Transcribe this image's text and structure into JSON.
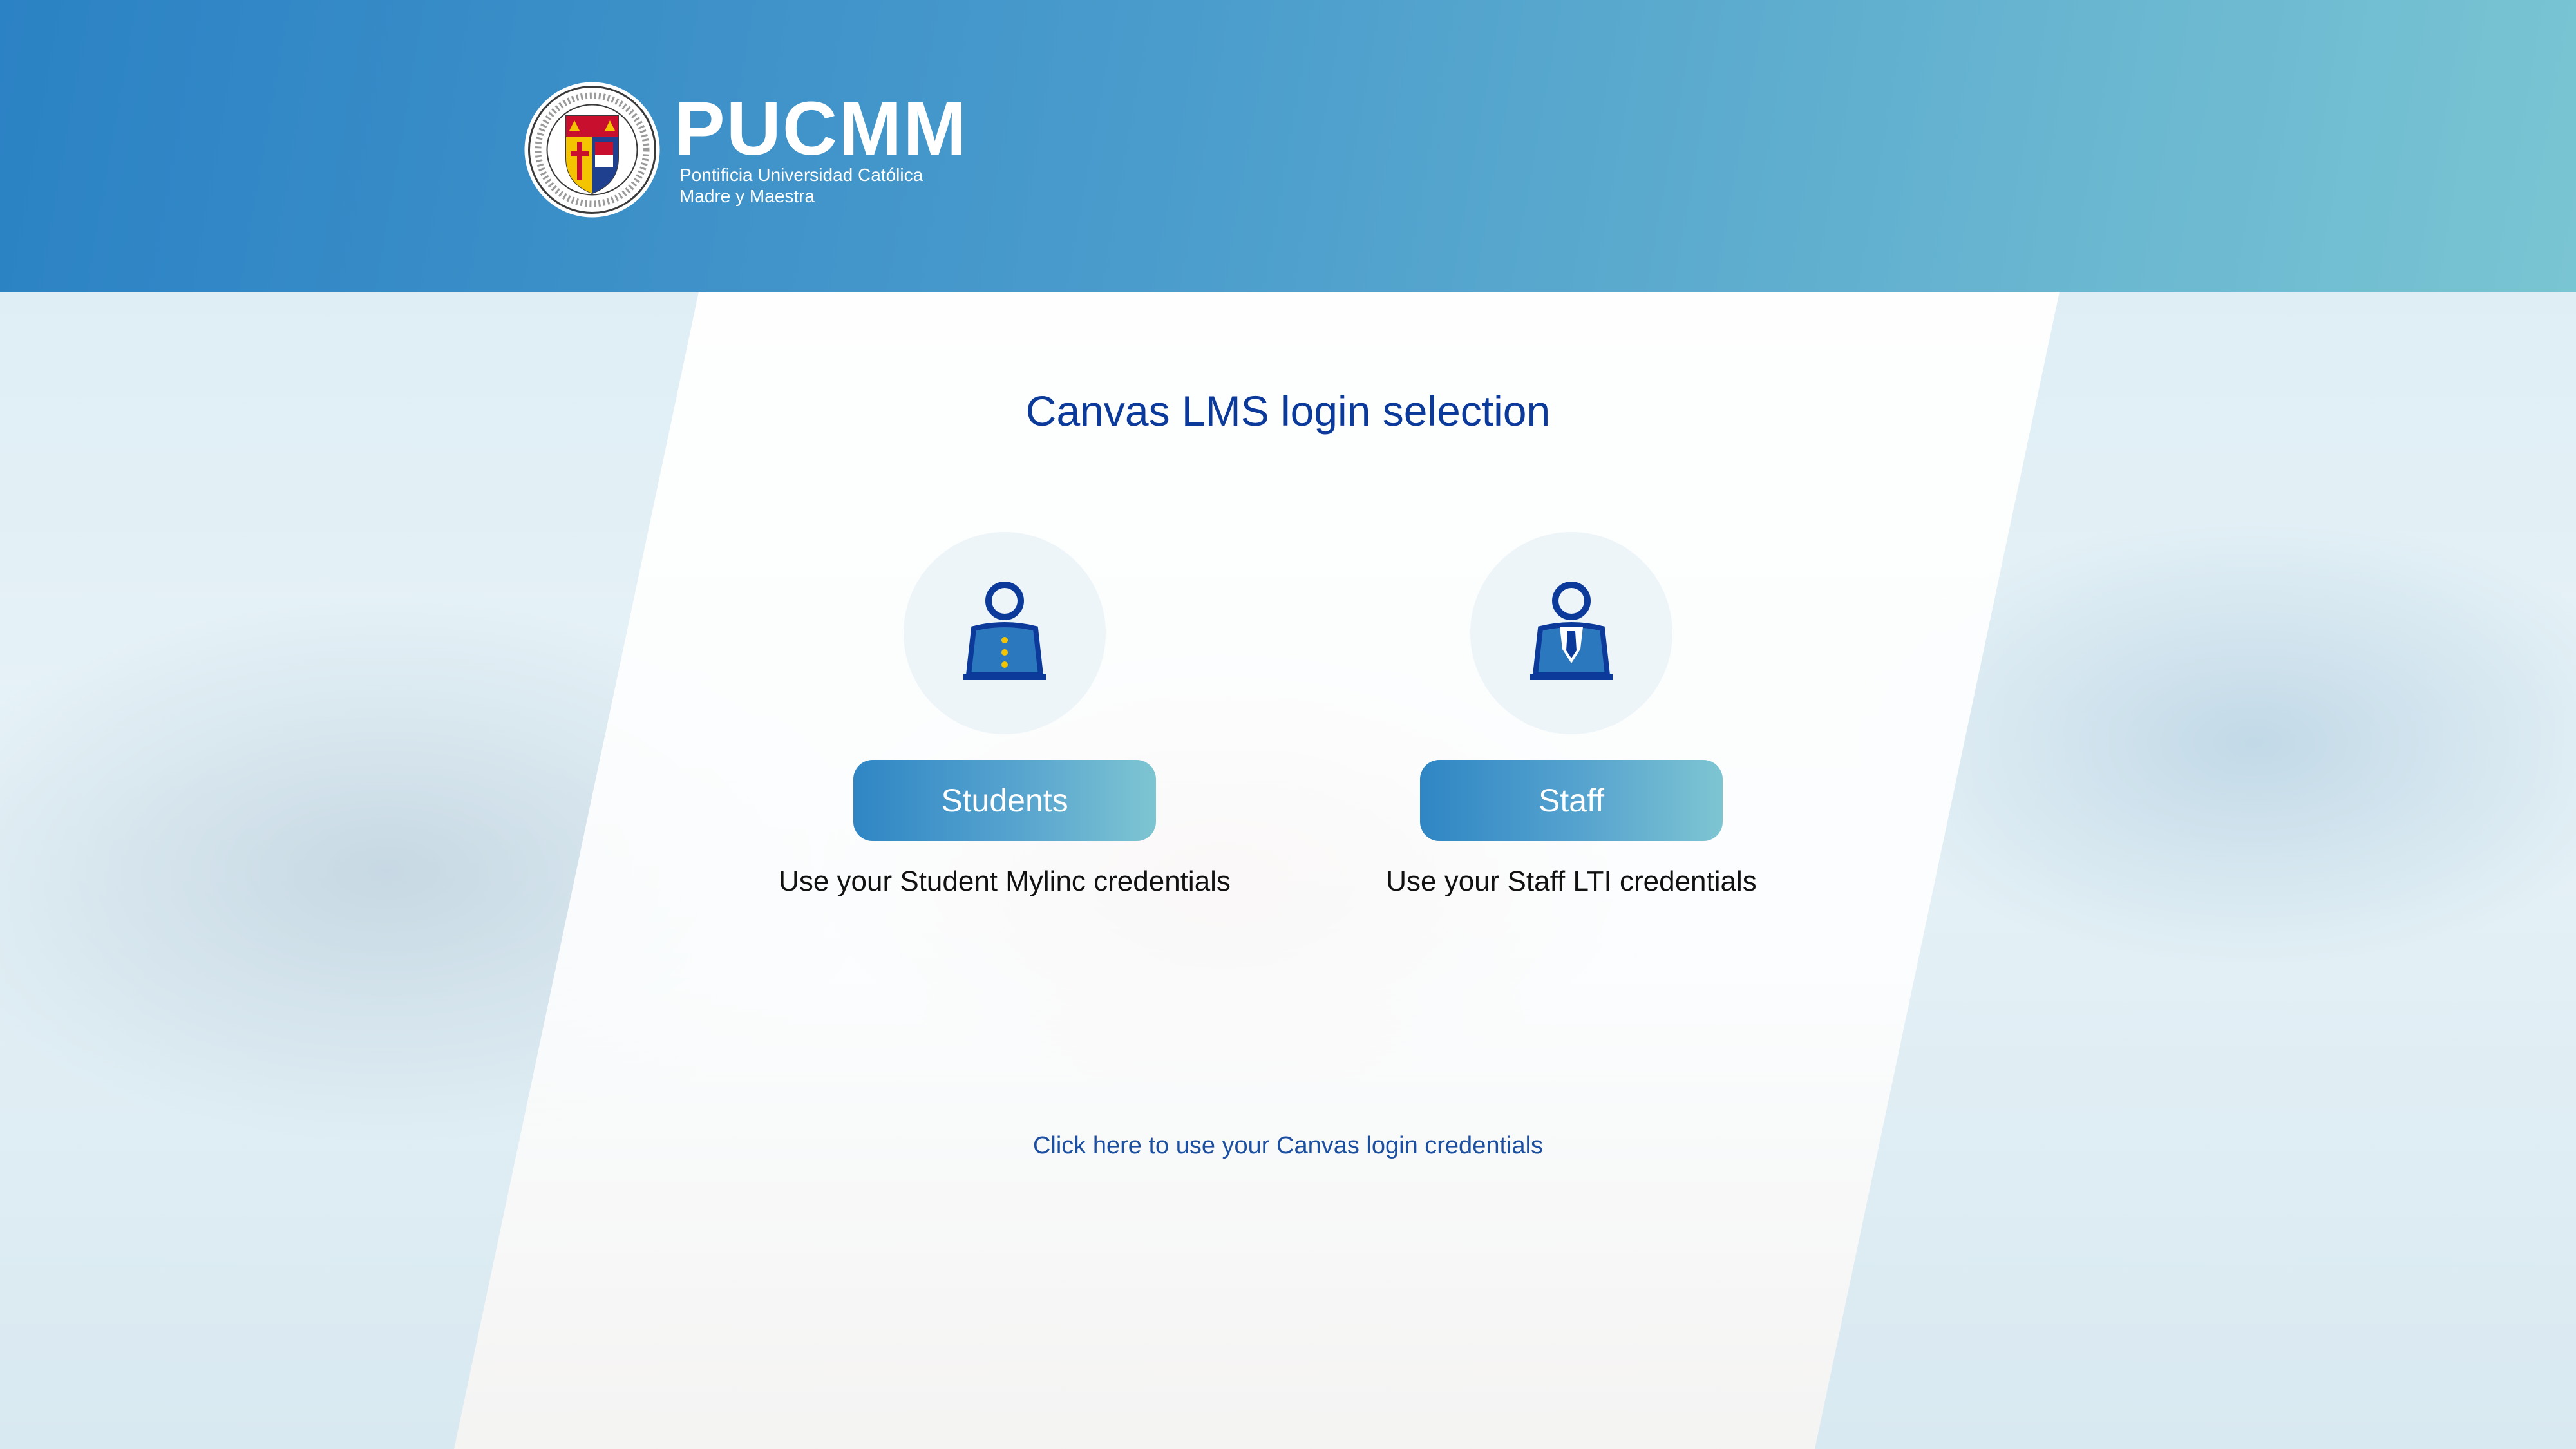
{
  "header": {
    "logo_name": "PUCMM",
    "logo_subtitle_line1": "Pontificia Universidad Católica",
    "logo_subtitle_line2": "Madre y Maestra"
  },
  "main": {
    "title": "Canvas LMS login selection",
    "options": [
      {
        "icon": "student-icon",
        "button_label": "Students",
        "description": "Use your Student Mylinc credentials"
      },
      {
        "icon": "staff-icon",
        "button_label": "Staff",
        "description": "Use your Staff LTI credentials"
      }
    ],
    "canvas_login_link": "Click here to use your Canvas login credentials"
  },
  "colors": {
    "header_start": "#2b82c4",
    "header_end": "#7ac5d3",
    "title": "#0b3a9a",
    "icon_blue": "#0b3a9a",
    "link": "#1c4fa0"
  }
}
